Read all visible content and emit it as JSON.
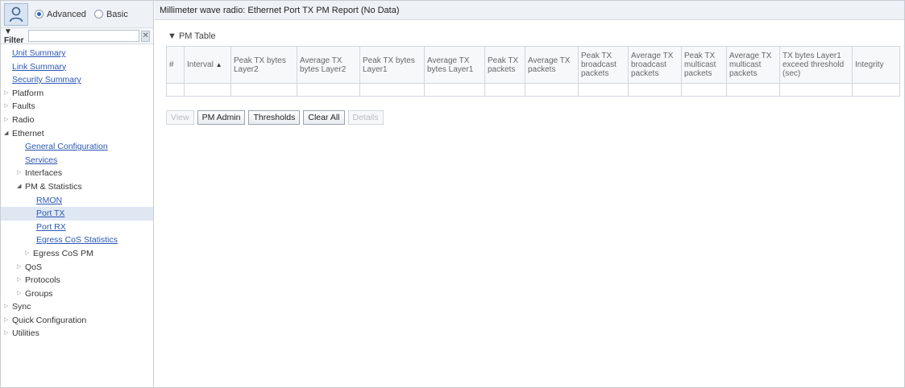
{
  "mode": {
    "advanced": "Advanced",
    "basic": "Basic"
  },
  "filter": {
    "label": "▼ Filter",
    "value": "",
    "clear": "✕"
  },
  "tree": {
    "unit_summary": "Unit Summary",
    "link_summary": "Link Summary",
    "security_summary": "Security Summary",
    "platform": "Platform",
    "faults": "Faults",
    "radio": "Radio",
    "ethernet": "Ethernet",
    "general_configuration": "General Configuration",
    "services": "Services",
    "interfaces": "Interfaces",
    "pm_statistics": "PM & Statistics",
    "rmon": "RMON",
    "port_tx": "Port TX",
    "port_rx": "Port RX",
    "egress_cos_statistics": "Egress CoS Statistics",
    "egress_cos_pm": "Egress CoS PM",
    "qos": "QoS",
    "protocols": "Protocols",
    "groups": "Groups",
    "sync": "Sync",
    "quick_configuration": "Quick Configuration",
    "utilities": "Utilities"
  },
  "page": {
    "title": "Millimeter wave radio: Ethernet Port TX PM Report (No Data)",
    "section": "▼ PM Table"
  },
  "table": {
    "columns": [
      "#",
      "Interval",
      "Peak TX bytes Layer2",
      "Average TX bytes Layer2",
      "Peak TX bytes Layer1",
      "Average TX bytes Layer1",
      "Peak TX packets",
      "Average TX packets",
      "Peak TX broadcast packets",
      "Average TX broadcast packets",
      "Peak TX multicast packets",
      "Average TX multicast packets",
      "TX bytes Layer1 exceed threshold (sec)",
      "Integrity"
    ],
    "sort_indicator": "▲"
  },
  "buttons": {
    "view": "View",
    "pm_admin": "PM Admin",
    "thresholds": "Thresholds",
    "clear_all": "Clear All",
    "details": "Details"
  },
  "colors": {
    "link": "#2b57b5",
    "selected_row": "#dfe7f3",
    "header_bg": "#eef2f7"
  }
}
